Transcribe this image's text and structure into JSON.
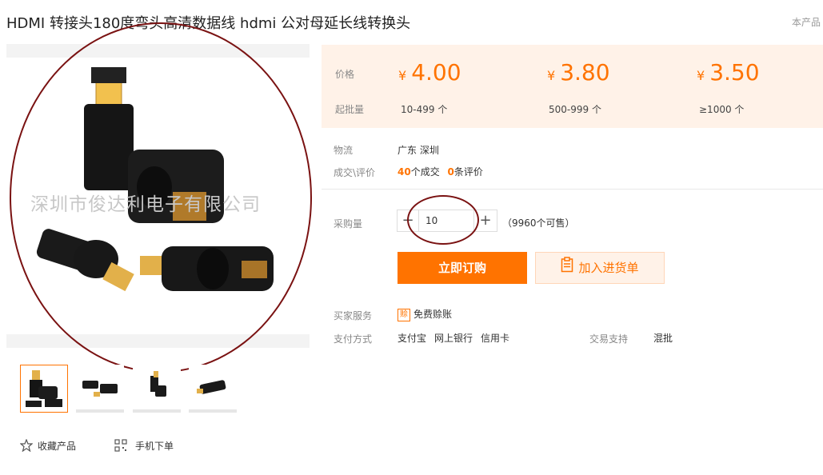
{
  "product": {
    "title": "HDMI 转接头180度弯头高清数据线 hdmi 公对母延长线转换头",
    "notice": "本产品"
  },
  "gallery": {
    "watermark": "深圳市俊达利电子有限公司"
  },
  "pricing": {
    "price_label": "价格",
    "moq_label": "起批量",
    "currency": "¥",
    "tiers": [
      {
        "price": "4.00",
        "range": "10-499 个"
      },
      {
        "price": "3.80",
        "range": "500-999 个"
      },
      {
        "price": "3.50",
        "range": "≥1000 个"
      }
    ]
  },
  "logistics": {
    "label": "物流",
    "value": "广东 深圳"
  },
  "deals": {
    "label": "成交\\评价",
    "deal_count": "40",
    "deal_suffix": "个成交",
    "review_count": "0",
    "review_suffix": "条评价"
  },
  "purchase": {
    "label": "采购量",
    "minus": "−",
    "plus": "+",
    "quantity": "10",
    "available": "（9960个可售）",
    "buy_now": "立即订购",
    "add_to_cart": "加入进货单"
  },
  "services": {
    "label": "买家服务",
    "badge": "赊",
    "value": "免费赊账"
  },
  "payment": {
    "label": "支付方式",
    "methods": [
      "支付宝",
      "网上银行",
      "信用卡"
    ],
    "trade_label": "交易支持",
    "trade_value": "混批"
  },
  "footer": {
    "favorite": "收藏产品",
    "mobile_order": "手机下单"
  },
  "colors": {
    "accent": "#ff7300",
    "price_bg": "#fff2e8",
    "annotation": "#7a1212"
  }
}
